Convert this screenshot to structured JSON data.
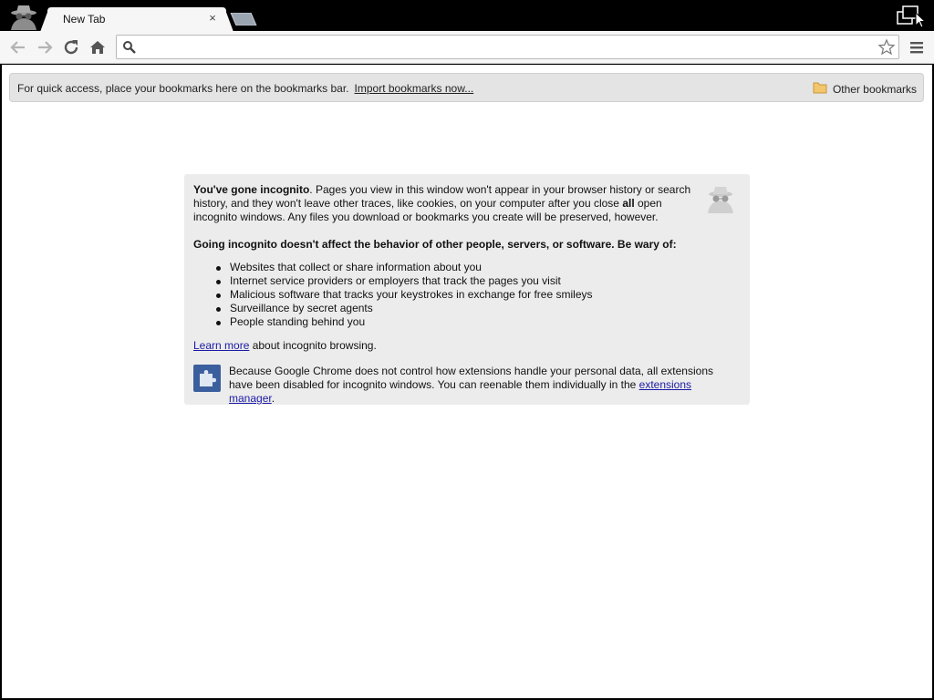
{
  "tab": {
    "title": "New Tab",
    "close_glyph": "×"
  },
  "omnibox": {
    "value": "",
    "placeholder": ""
  },
  "bookmarks_bar": {
    "message": "For quick access, place your bookmarks here on the bookmarks bar.",
    "import_link": "Import bookmarks now...",
    "other_bookmarks": "Other bookmarks"
  },
  "incognito": {
    "intro_bold": "You've gone incognito",
    "intro_part1": ". Pages you view in this window won't appear in your browser history or search history, and they won't leave other traces, like cookies, on your computer after you close ",
    "intro_all": "all",
    "intro_part2": " open incognito windows. Any files you download or bookmarks you create will be preserved, however.",
    "warning_heading": "Going incognito doesn't affect the behavior of other people, servers, or software. Be wary of:",
    "warnings": [
      "Websites that collect or share information about you",
      "Internet service providers or employers that track the pages you visit",
      "Malicious software that tracks your keystrokes in exchange for free smileys",
      "Surveillance by secret agents",
      "People standing behind you"
    ],
    "learn_more_link": "Learn more",
    "learn_more_rest": " about incognito browsing.",
    "extensions_text": "Because Google Chrome does not control how extensions handle your personal data, all extensions have been disabled for incognito windows. You can reenable them individually in the ",
    "extensions_link": "extensions manager",
    "extensions_end": "."
  },
  "icons": {
    "incognito_badge": "incognito-spy-icon",
    "back": "back-arrow-icon",
    "forward": "forward-arrow-icon",
    "reload": "reload-icon",
    "home": "home-icon",
    "search": "search-icon",
    "star": "star-icon",
    "menu": "menu-icon",
    "folder": "folder-icon",
    "puzzle": "puzzle-icon"
  },
  "colors": {
    "link": "#1a1aa6",
    "incognito_box": "#ececec",
    "bookmarks_bar": "#e4e4e4",
    "frame": "#000000"
  }
}
